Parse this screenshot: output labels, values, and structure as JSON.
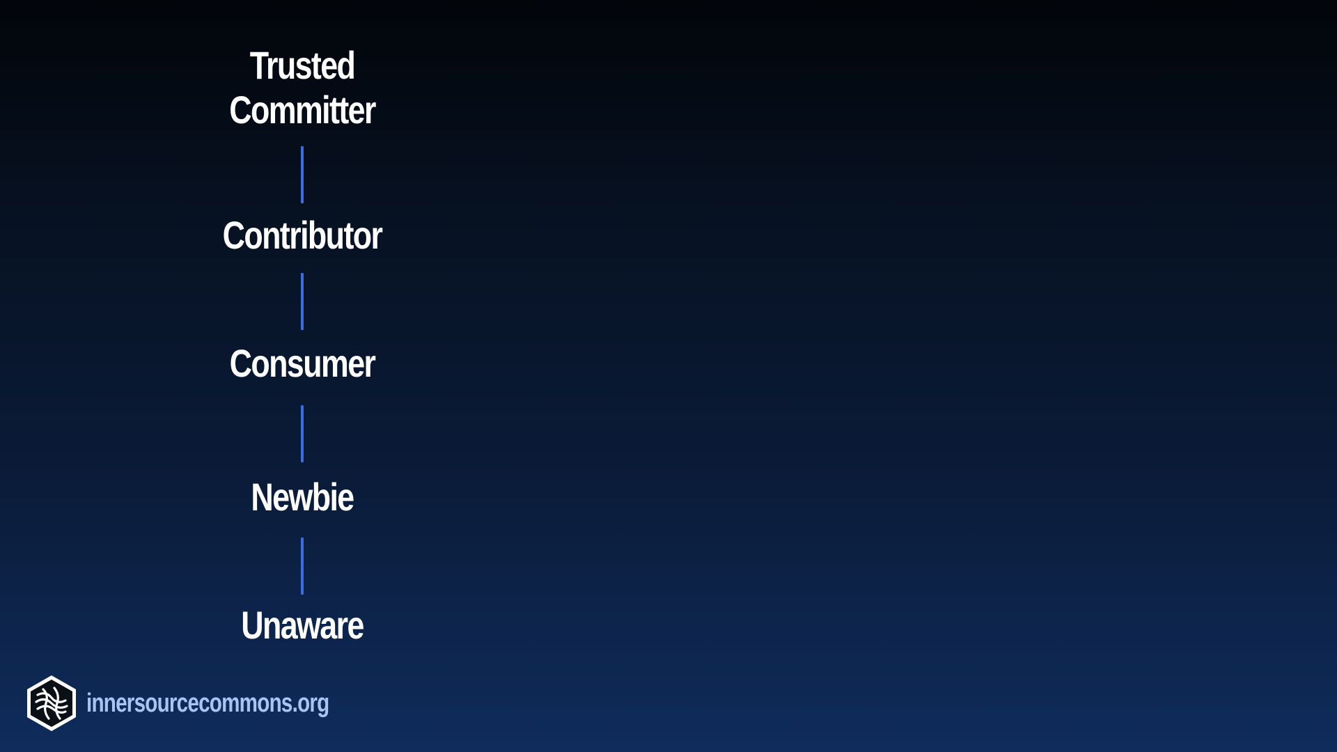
{
  "diagram": {
    "levels": [
      {
        "label": "Trusted\nCommitter"
      },
      {
        "label": "Contributor"
      },
      {
        "label": "Consumer"
      },
      {
        "label": "Newbie"
      },
      {
        "label": "Unaware"
      }
    ]
  },
  "footer": {
    "url": "innersourcecommons.org",
    "logo_icon": "innersource-commons-hexagon-logo-icon"
  },
  "colors": {
    "background_top": "#02050a",
    "background_bottom": "#0f2c5c",
    "label": "#ffffff",
    "connector": "#3a6ee0",
    "url": "#a8c4f2"
  }
}
